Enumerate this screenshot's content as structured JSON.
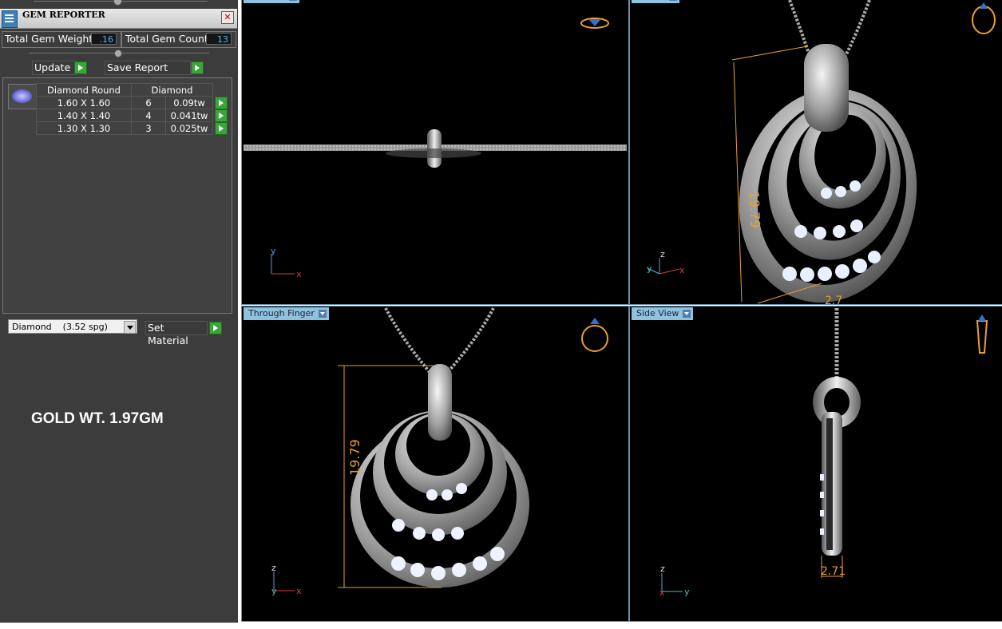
{
  "gem_reporter": {
    "title": "GEM REPORTER",
    "close_label": "✕",
    "total_weight_label": "Total Gem Weight",
    "total_weight_value": ".16",
    "total_count_label": "Total Gem Count",
    "total_count_value": "13",
    "update_label": "Update",
    "save_report_label": "Save Report",
    "columns": [
      "Diamond Round",
      "Diamond"
    ],
    "rows": [
      {
        "size": "1.60 X 1.60",
        "count": "6",
        "weight": "0.09tw"
      },
      {
        "size": "1.40 X 1.40",
        "count": "4",
        "weight": "0.041tw"
      },
      {
        "size": "1.30 X 1.30",
        "count": "3",
        "weight": "0.025tw"
      }
    ]
  },
  "material": {
    "name": "Diamond",
    "spg": "(3.52 spg)",
    "set_label": "Set Material"
  },
  "gold_weight": "GOLD WT. 1.97GM",
  "viewports": {
    "top_left": {
      "tab": "",
      "axes": [
        "y",
        "x"
      ]
    },
    "top_right": {
      "tab": "",
      "dimension": "19.79",
      "dimension_small": "2.7",
      "axes": [
        "z",
        "y",
        "x"
      ]
    },
    "bottom_left": {
      "tab": "Through Finger",
      "dimension": "19.79",
      "axes": [
        "z",
        "y",
        "x"
      ]
    },
    "bottom_right": {
      "tab": "Side View",
      "dimension": "2.71",
      "axes": [
        "z",
        "x",
        "y"
      ]
    }
  },
  "colors": {
    "panel_bg": "#3c3c3c",
    "viewport_bg": "#000000",
    "field_text": "#5ab4e8",
    "action_green": "#3aa53a",
    "dimension": "#e8a030",
    "tab": "#8ec2df"
  },
  "icons": [
    "gem-reporter-icon",
    "close-icon",
    "play-arrow-icon",
    "round-diamond-icon",
    "dropdown-icon",
    "ring-view-icon"
  ]
}
